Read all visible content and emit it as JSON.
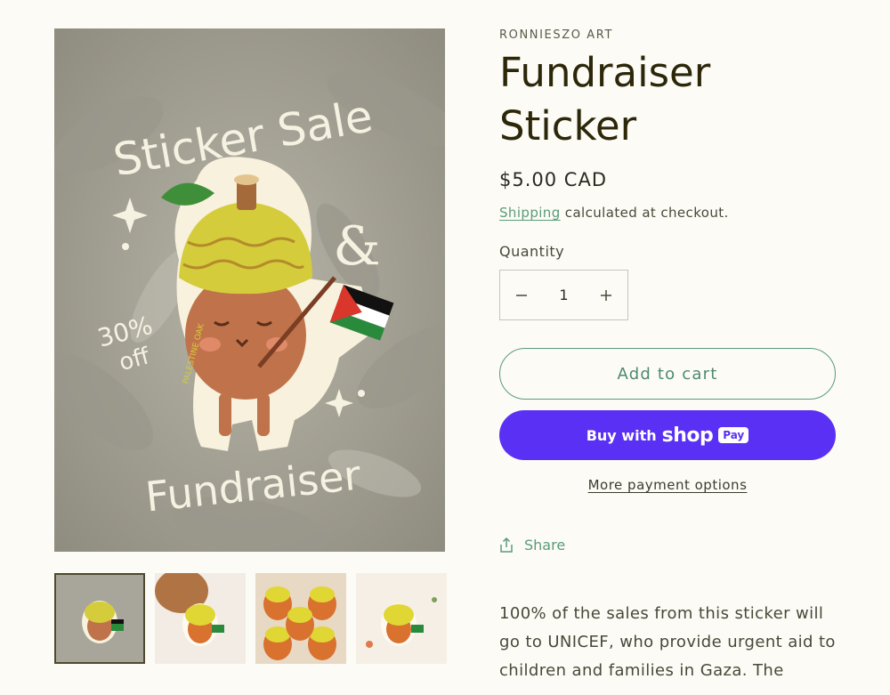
{
  "product": {
    "vendor": "RONNIESZO ART",
    "title": "Fundraiser Sticker",
    "price": "$5.00 CAD",
    "shipping_link": "Shipping",
    "shipping_rest": " calculated at checkout.",
    "quantity_label": "Quantity",
    "quantity_value": "1",
    "add_to_cart": "Add to cart",
    "buy_with": "Buy with",
    "shop_word": "shop",
    "pay_badge": "Pay",
    "more_payment": "More payment options",
    "share": "Share",
    "description": "100% of the sales from this sticker will go to UNICEF, who provide urgent aid to children and families in Gaza. The"
  },
  "artwork": {
    "line1": "Sticker Sale",
    "ampersand": "&",
    "discount_line1": "30%",
    "discount_line2": "off",
    "bottom": "Fundraiser",
    "badge_text": "PALESTINE OAK"
  },
  "colors": {
    "accent": "#5a9c7a",
    "shop_pay": "#5a31f4",
    "title": "#2d2709",
    "background": "#fcfbf6"
  },
  "icons": {
    "minus": "minus-icon",
    "plus": "plus-icon",
    "share": "share-icon"
  }
}
